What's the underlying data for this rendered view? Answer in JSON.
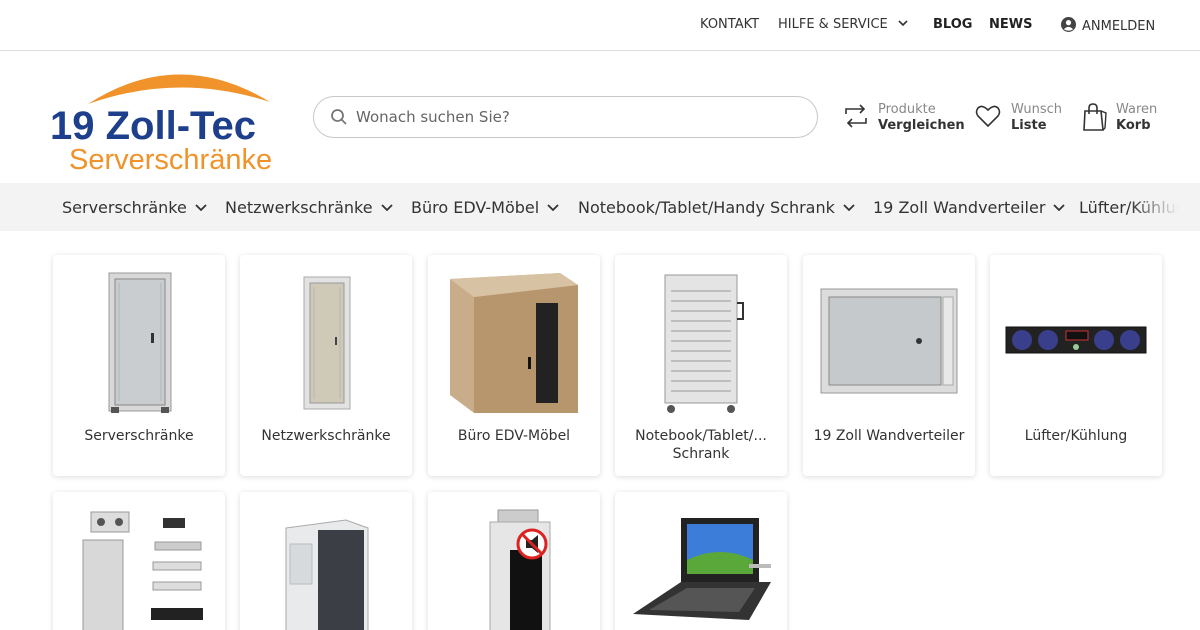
{
  "topbar": {
    "kontakt": "KONTAKT",
    "hilfe": "HILFE & SERVICE",
    "blog": "BLOG",
    "news": "NEWS",
    "login": "ANMELDEN"
  },
  "logo": {
    "line1": "19 Zoll-Tec",
    "line2": "Serverschränke",
    "colors": {
      "blue": "#1d3f8c",
      "orange": "#f0932b"
    }
  },
  "search": {
    "placeholder": "Wonach suchen Sie?"
  },
  "header_actions": {
    "compare": {
      "line1": "Produkte",
      "line2": "Vergleichen",
      "icon": "compare-arrows-icon"
    },
    "wishlist": {
      "line1": "Wunsch",
      "line2": "Liste",
      "icon": "heart-icon"
    },
    "cart": {
      "line1": "Waren",
      "line2": "Korb",
      "icon": "shopping-bag-icon"
    }
  },
  "categories": [
    {
      "label": "Serverschränke"
    },
    {
      "label": "Netzwerkschränke"
    },
    {
      "label": "Büro EDV-Möbel"
    },
    {
      "label": "Notebook/Tablet/Handy Schrank"
    },
    {
      "label": "19 Zoll Wandverteiler"
    },
    {
      "label": "Lüfter/Kühlung"
    }
  ],
  "products": [
    {
      "label": "Serverschränke"
    },
    {
      "label": "Netzwerkschränke"
    },
    {
      "label": "Büro EDV-Möbel"
    },
    {
      "label": "Notebook/Tablet/... Schrank"
    },
    {
      "label": "19 Zoll Wandverteiler"
    },
    {
      "label": "Lüfter/Kühlung"
    },
    {
      "label": ""
    },
    {
      "label": ""
    },
    {
      "label": ""
    },
    {
      "label": ""
    }
  ]
}
